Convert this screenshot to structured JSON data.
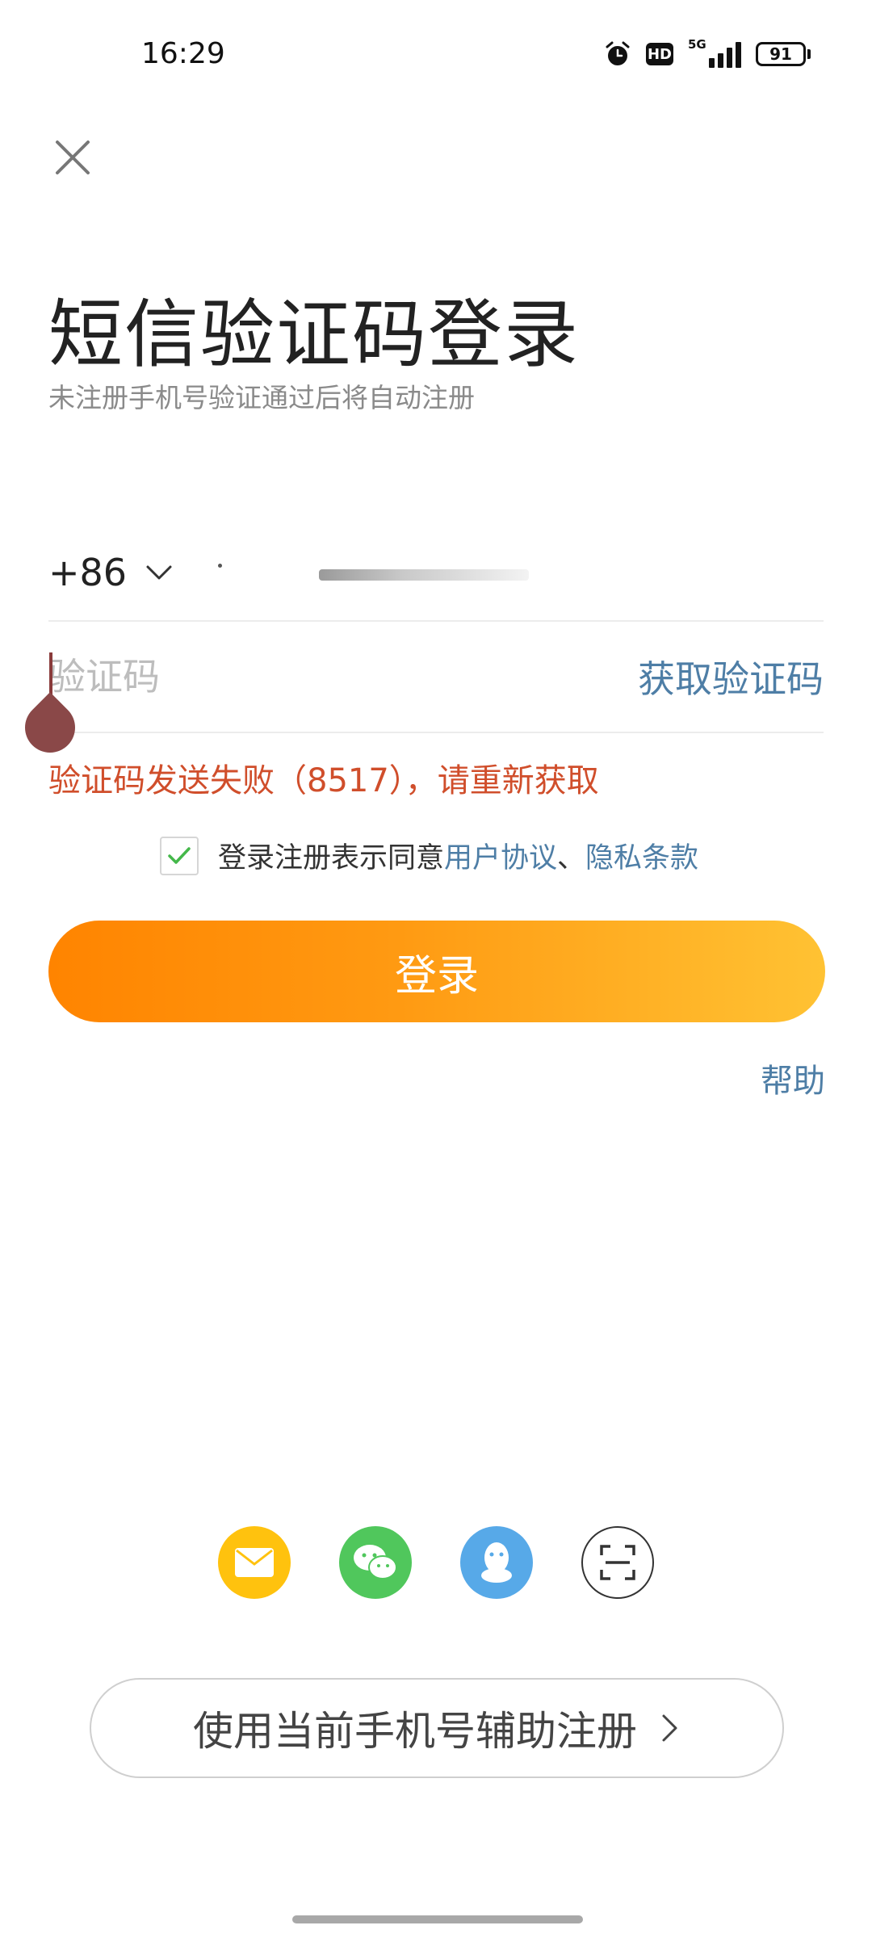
{
  "status_bar": {
    "time": "16:29",
    "hd": "HD",
    "network": "5G",
    "battery": "91",
    "icons": [
      "alarm-icon",
      "hd-icon",
      "signal-icon",
      "battery-icon"
    ]
  },
  "header": {
    "close_icon": "close-icon",
    "title": "短信验证码登录",
    "subtitle": "未注册手机号验证通过后将自动注册"
  },
  "phone": {
    "country_code": "+86",
    "chevron_icon": "chevron-down-icon"
  },
  "code": {
    "placeholder": "验证码",
    "get_code_label": "获取验证码"
  },
  "error": {
    "message": "验证码发送失败（8517），请重新获取"
  },
  "agreement": {
    "checked": true,
    "prefix": "登录注册表示同意",
    "user_agreement": "用户协议",
    "separator": "、",
    "privacy": "隐私条款"
  },
  "login_button": {
    "label": "登录"
  },
  "help": {
    "label": "帮助"
  },
  "social": [
    {
      "name": "mail-icon",
      "color": "#ffc20e"
    },
    {
      "name": "wechat-icon",
      "color": "#50c75c"
    },
    {
      "name": "qq-icon",
      "color": "#57a9e8"
    },
    {
      "name": "scan-icon",
      "color": "#ffffff"
    }
  ],
  "assist_register": {
    "label": "使用当前手机号辅助注册",
    "arrow_icon": "chevron-right-icon"
  },
  "colors": {
    "accent": "#ff8400",
    "link": "#4e7ea6",
    "error": "#d04e2b"
  }
}
